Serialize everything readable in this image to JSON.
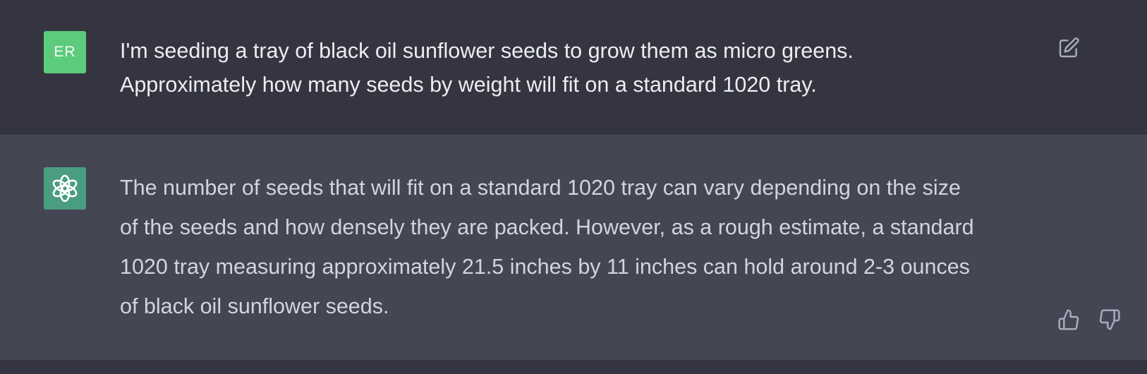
{
  "user_message": {
    "avatar_initials": "ER",
    "lines": [
      "I'm seeding a tray of black oil sunflower seeds to grow them as micro greens.",
      "Approximately how many seeds by weight will fit on a standard 1020 tray."
    ],
    "icons": {
      "edit": "edit-icon"
    }
  },
  "assistant_message": {
    "avatar_icon": "openai-logo-icon",
    "lines": [
      "The number of seeds that will fit on a standard 1020 tray can vary depending on the size",
      "of the seeds and how densely they are packed. However, as a rough estimate, a standard",
      "1020 tray measuring approximately 21.5 inches by 11 inches can hold around 2-3 ounces",
      "of black oil sunflower seeds."
    ],
    "icons": {
      "thumbs_up": "thumbs-up-icon",
      "thumbs_down": "thumbs-down-icon"
    }
  },
  "colors": {
    "page_bg": "#343541",
    "assistant_bg": "#444654",
    "user_avatar": "#5ccb7b",
    "assistant_avatar": "#4a9d80",
    "text": "#ececf1",
    "icon": "#acacbe"
  }
}
